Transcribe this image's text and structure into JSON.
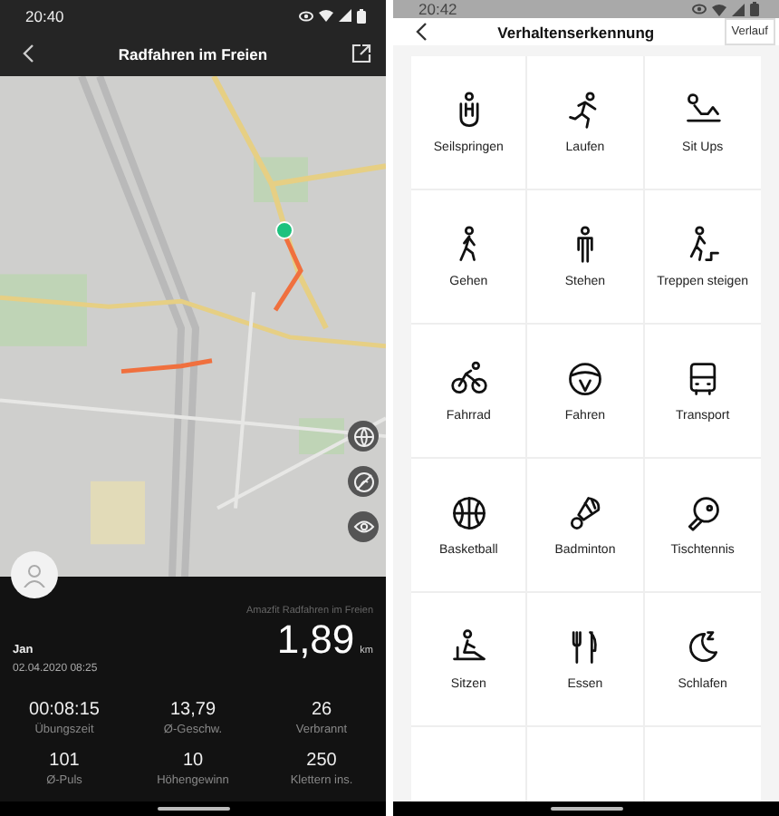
{
  "left_screen": {
    "status_bar": {
      "time": "20:40"
    },
    "title": "Radfahren im Freien",
    "summary": {
      "user": "Jan",
      "date": "02.04.2020 08:25",
      "source": "Amazfit Radfahren im Freien",
      "distance": "1,89",
      "unit": "km"
    },
    "stats": [
      {
        "value": "00:08:15",
        "label": "Übungszeit"
      },
      {
        "value": "13,79",
        "label": "Ø-Geschw."
      },
      {
        "value": "26",
        "label": "Verbrannt"
      },
      {
        "value": "101",
        "label": "Ø-Puls"
      },
      {
        "value": "10",
        "label": "Höhengewinn"
      },
      {
        "value": "250",
        "label": "Klettern ins."
      }
    ]
  },
  "right_screen": {
    "status_bar": {
      "time": "20:42"
    },
    "title": "Verhaltenserkennung",
    "history_button": "Verlauf",
    "activities": [
      {
        "label": "Seilspringen",
        "kind": "rope"
      },
      {
        "label": "Laufen",
        "kind": "run"
      },
      {
        "label": "Sit Ups",
        "kind": "situp"
      },
      {
        "label": "Gehen",
        "kind": "walk"
      },
      {
        "label": "Stehen",
        "kind": "stand"
      },
      {
        "label": "Treppen steigen",
        "kind": "stairs"
      },
      {
        "label": "Fahrrad",
        "kind": "bike"
      },
      {
        "label": "Fahren",
        "kind": "wheel"
      },
      {
        "label": "Transport",
        "kind": "bus"
      },
      {
        "label": "Basketball",
        "kind": "ball"
      },
      {
        "label": "Badminton",
        "kind": "shuttle"
      },
      {
        "label": "Tischtennis",
        "kind": "paddle"
      },
      {
        "label": "Sitzen",
        "kind": "sit"
      },
      {
        "label": "Essen",
        "kind": "eat"
      },
      {
        "label": "Schlafen",
        "kind": "sleep"
      }
    ]
  }
}
